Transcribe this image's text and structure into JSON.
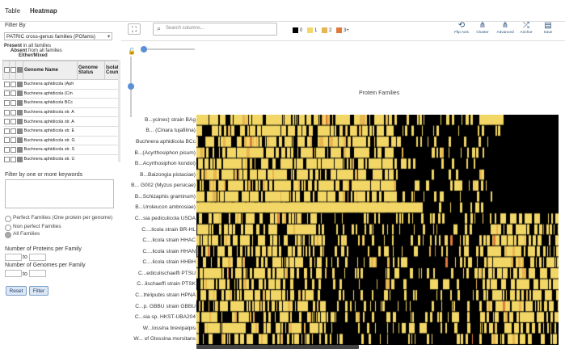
{
  "tabs": [
    {
      "label": "Table"
    },
    {
      "label": "Heatmap"
    }
  ],
  "filter": {
    "title": "Filter By",
    "select_value": "PATRIC cross-genus families (PGfams)",
    "present_bold": "Present",
    "present_rest": " in all families",
    "absent_bold": "Absent",
    "absent_rest": " from all families",
    "either": "Either/Mixed",
    "columns": [
      "Genome Name",
      "Genome Status",
      "Isolat Count"
    ],
    "rows": [
      {
        "name": "Buchnera aphidicola (Aph",
        "c3": true
      },
      {
        "name": "Buchnera aphidicola (Cin",
        "c3": true
      },
      {
        "name": "Buchnera aphidicola BCc",
        "c3": true
      },
      {
        "name": "Buchnera aphidicola str. A",
        "c3": true
      },
      {
        "name": "Buchnera aphidicola str. A",
        "c3": true
      },
      {
        "name": "Buchnera aphidicola str. E",
        "c3": true
      },
      {
        "name": "Buchnera aphidicola str. G",
        "c3": true
      },
      {
        "name": "Buchnera aphidicola str. S",
        "c3": true
      },
      {
        "name": "Buchnera aphidicola str. U",
        "c3": true
      },
      {
        "name": "Candidatus Riesia pedicu",
        "c3": true
      }
    ],
    "keywords_label": "Filter by one or more keywords",
    "radios": [
      {
        "label": "Perfect Families (One protein per genome)",
        "checked": false
      },
      {
        "label": "Non perfect Families",
        "checked": false
      },
      {
        "label": "All Families",
        "checked": true
      }
    ],
    "proteins_label": "Number of Proteins per Family",
    "genomes_label": "Number of Genomes per Family",
    "to": "to",
    "reset": "Reset",
    "filter_btn": "Filter"
  },
  "toolbar": {
    "search_placeholder": "Search columns...",
    "legend": [
      {
        "label": "0",
        "color": "#000000"
      },
      {
        "label": "1",
        "color": "#f2d766"
      },
      {
        "label": "2",
        "color": "#e8b550"
      },
      {
        "label": "3+",
        "color": "#e07a3a"
      }
    ],
    "icons": [
      {
        "name": "flip-axis",
        "glyph": "⟲",
        "label": "Flip Axis"
      },
      {
        "name": "cluster",
        "glyph": "⋔",
        "label": "Cluster"
      },
      {
        "name": "advanced",
        "glyph": "⋔",
        "label": "Advanced"
      },
      {
        "name": "anchor",
        "glyph": "⤮",
        "label": "Anchor"
      },
      {
        "name": "save",
        "glyph": "▤",
        "label": "Save"
      }
    ]
  },
  "heatmap": {
    "axis_title": "Protein Families",
    "row_labels": [
      "B...ycines) strain BAg",
      "B... (Cinara tujafilina)",
      "Buchnera aphidicola BCc",
      "B...(Acyrthosiphon pisum)",
      "B...Acyrthosiphon kondoi)",
      "B...Baizongia pistaciae)",
      "B... G002 (Myzus persicae)",
      "B...Schizaphis graminum)",
      "B...Uroleucon ambrosiae)",
      "C...sia pediculicola USDA",
      "C....licola strain BR-HL",
      "C....licola strain HHAC",
      "C....licola strain HHAN",
      "C....licola strain HHBH",
      "C...ediculischaeffi PTSU",
      "C...lischaeffi strain PTSK",
      "C...thiripubis strain HPNA",
      "C...p. GBBU strain GBBU",
      "C...sia sp. HKST-UBA204",
      "W...lossina brevipalpis",
      "W... of Glossina morsitans"
    ]
  }
}
